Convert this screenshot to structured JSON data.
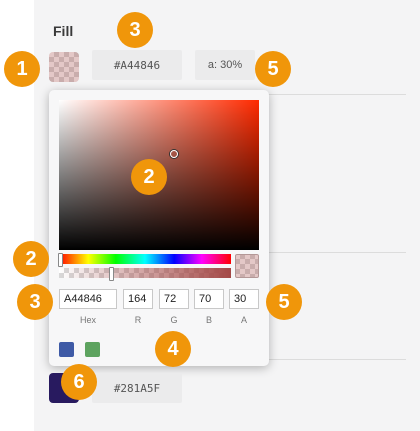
{
  "fill": {
    "label": "Fill",
    "hex": "#A44846",
    "alpha_label": "a: 30%"
  },
  "picker": {
    "hex_value": "A44846",
    "r": "164",
    "g": "72",
    "b": "70",
    "a": "30",
    "labels": {
      "hex": "Hex",
      "r": "R",
      "g": "G",
      "b": "B",
      "a": "A"
    },
    "alpha_percent": 30,
    "presets": [
      {
        "name": "preset-blue",
        "color": "#3e5aa6"
      },
      {
        "name": "preset-green",
        "color": "#5da35f"
      }
    ]
  },
  "second_fill": {
    "hex": "#281A5F",
    "color": "#281A5F"
  },
  "badges": [
    "1",
    "2",
    "2",
    "3",
    "3",
    "4",
    "5",
    "5",
    "6"
  ],
  "colors": {
    "badge": "#f0960a",
    "fill": "#A44846",
    "hue_base": "#ff2a00"
  }
}
